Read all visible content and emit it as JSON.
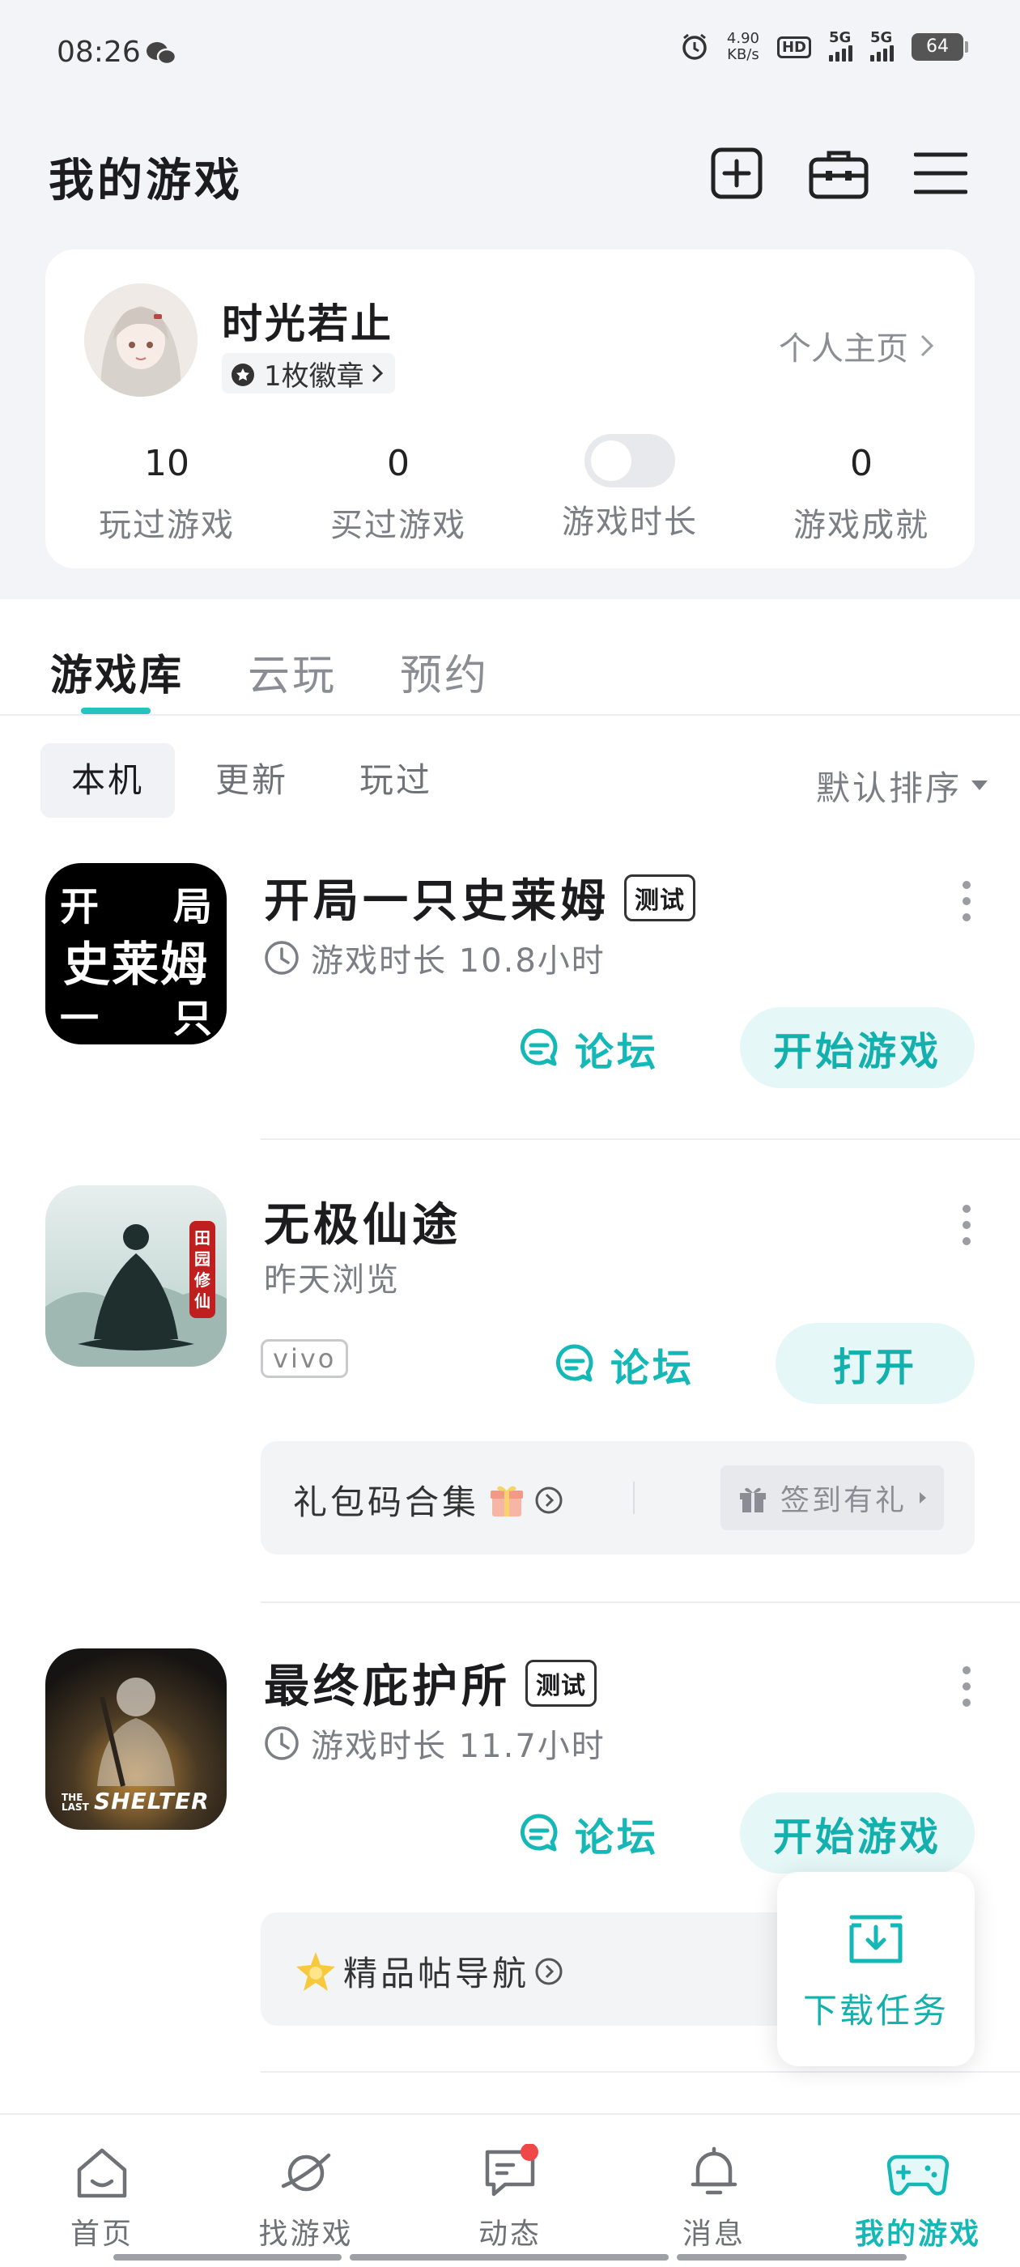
{
  "status_bar": {
    "time": "08:26",
    "speed_value": "4.90",
    "speed_unit": "KB/s",
    "hd": "HD",
    "net1": "5G",
    "net2": "5G",
    "battery": "64"
  },
  "header": {
    "title": "我的游戏",
    "icons": [
      "add-icon",
      "toolbox-icon",
      "menu-icon"
    ]
  },
  "profile": {
    "username": "时光若止",
    "badges": "1枚徽章",
    "home_link": "个人主页",
    "stats": [
      {
        "value": "10",
        "label": "玩过游戏"
      },
      {
        "value": "0",
        "label": "买过游戏"
      },
      {
        "value": "",
        "label": "游戏时长",
        "toggle_on": false
      },
      {
        "value": "0",
        "label": "游戏成就"
      }
    ]
  },
  "library": {
    "tabs": [
      "游戏库",
      "云玩",
      "预约"
    ],
    "active_tab": "游戏库",
    "subtabs": [
      "本机",
      "更新",
      "玩过"
    ],
    "active_subtab": "本机",
    "sort_label": "默认排序"
  },
  "games": [
    {
      "name": "开局一只史莱姆",
      "tag": "测试",
      "meta": "游戏时长 10.8小时",
      "forum": "论坛",
      "action": "开始游戏",
      "icon_text": [
        "开",
        "局",
        "史莱姆",
        "一",
        "只"
      ]
    },
    {
      "name": "无极仙途",
      "meta": "昨天浏览",
      "platform": "vivo",
      "forum": "论坛",
      "action": "打开",
      "icon_seal": "田园修仙",
      "gift": {
        "text": "礼包码合集",
        "button": "签到有礼"
      }
    },
    {
      "name": "最终庇护所",
      "tag": "测试",
      "meta": "游戏时长 11.7小时",
      "forum": "论坛",
      "action": "开始游戏",
      "icon_logo_small": "THE LAST",
      "icon_logo": "SHELTER",
      "banner": {
        "text": "精品帖导航"
      }
    }
  ],
  "download_task": {
    "label": "下载任务"
  },
  "bottom_nav": {
    "items": [
      "首页",
      "找游戏",
      "动态",
      "消息",
      "我的游戏"
    ],
    "active": "我的游戏"
  },
  "colors": {
    "accent": "#14b8b6",
    "accent_bg": "#e5f8f7",
    "notify": "#f04848"
  }
}
